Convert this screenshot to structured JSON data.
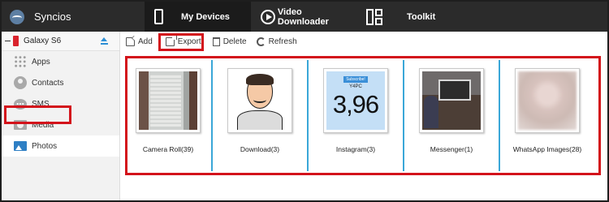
{
  "app": {
    "name": "Syncios"
  },
  "topnav": {
    "tabs": [
      {
        "label": "My Devices",
        "active": true,
        "icon": "phone-icon"
      },
      {
        "label": "Video Downloader",
        "active": false,
        "icon": "play-icon"
      },
      {
        "label": "Toolkit",
        "active": false,
        "icon": "toolkit-icon"
      }
    ]
  },
  "device": {
    "name": "Galaxy S6",
    "icon": "device-icon",
    "accent": "#d9232d"
  },
  "sidebar": {
    "items": [
      {
        "label": "Apps",
        "icon": "apps-icon"
      },
      {
        "label": "Contacts",
        "icon": "contacts-icon"
      },
      {
        "label": "SMS",
        "icon": "sms-icon"
      },
      {
        "label": "Media",
        "icon": "media-icon"
      },
      {
        "label": "Photos",
        "icon": "photos-icon",
        "active": true
      }
    ]
  },
  "toolbar": {
    "add": "Add",
    "export": "Export",
    "delete": "Delete",
    "refresh": "Refresh"
  },
  "albums": [
    {
      "label": "Camera Roll(39)"
    },
    {
      "label": "Download(3)"
    },
    {
      "label": "Instagram(3)",
      "thumb_text": {
        "badge": "Subscribe!",
        "name": "Y4PC",
        "count": "3,96"
      }
    },
    {
      "label": "Messenger(1)"
    },
    {
      "label": "WhatsApp Images(28)"
    }
  ],
  "colors": {
    "highlight": "#d3131b",
    "separator": "#3aa7d8",
    "topbar": "#2b2b2b"
  }
}
